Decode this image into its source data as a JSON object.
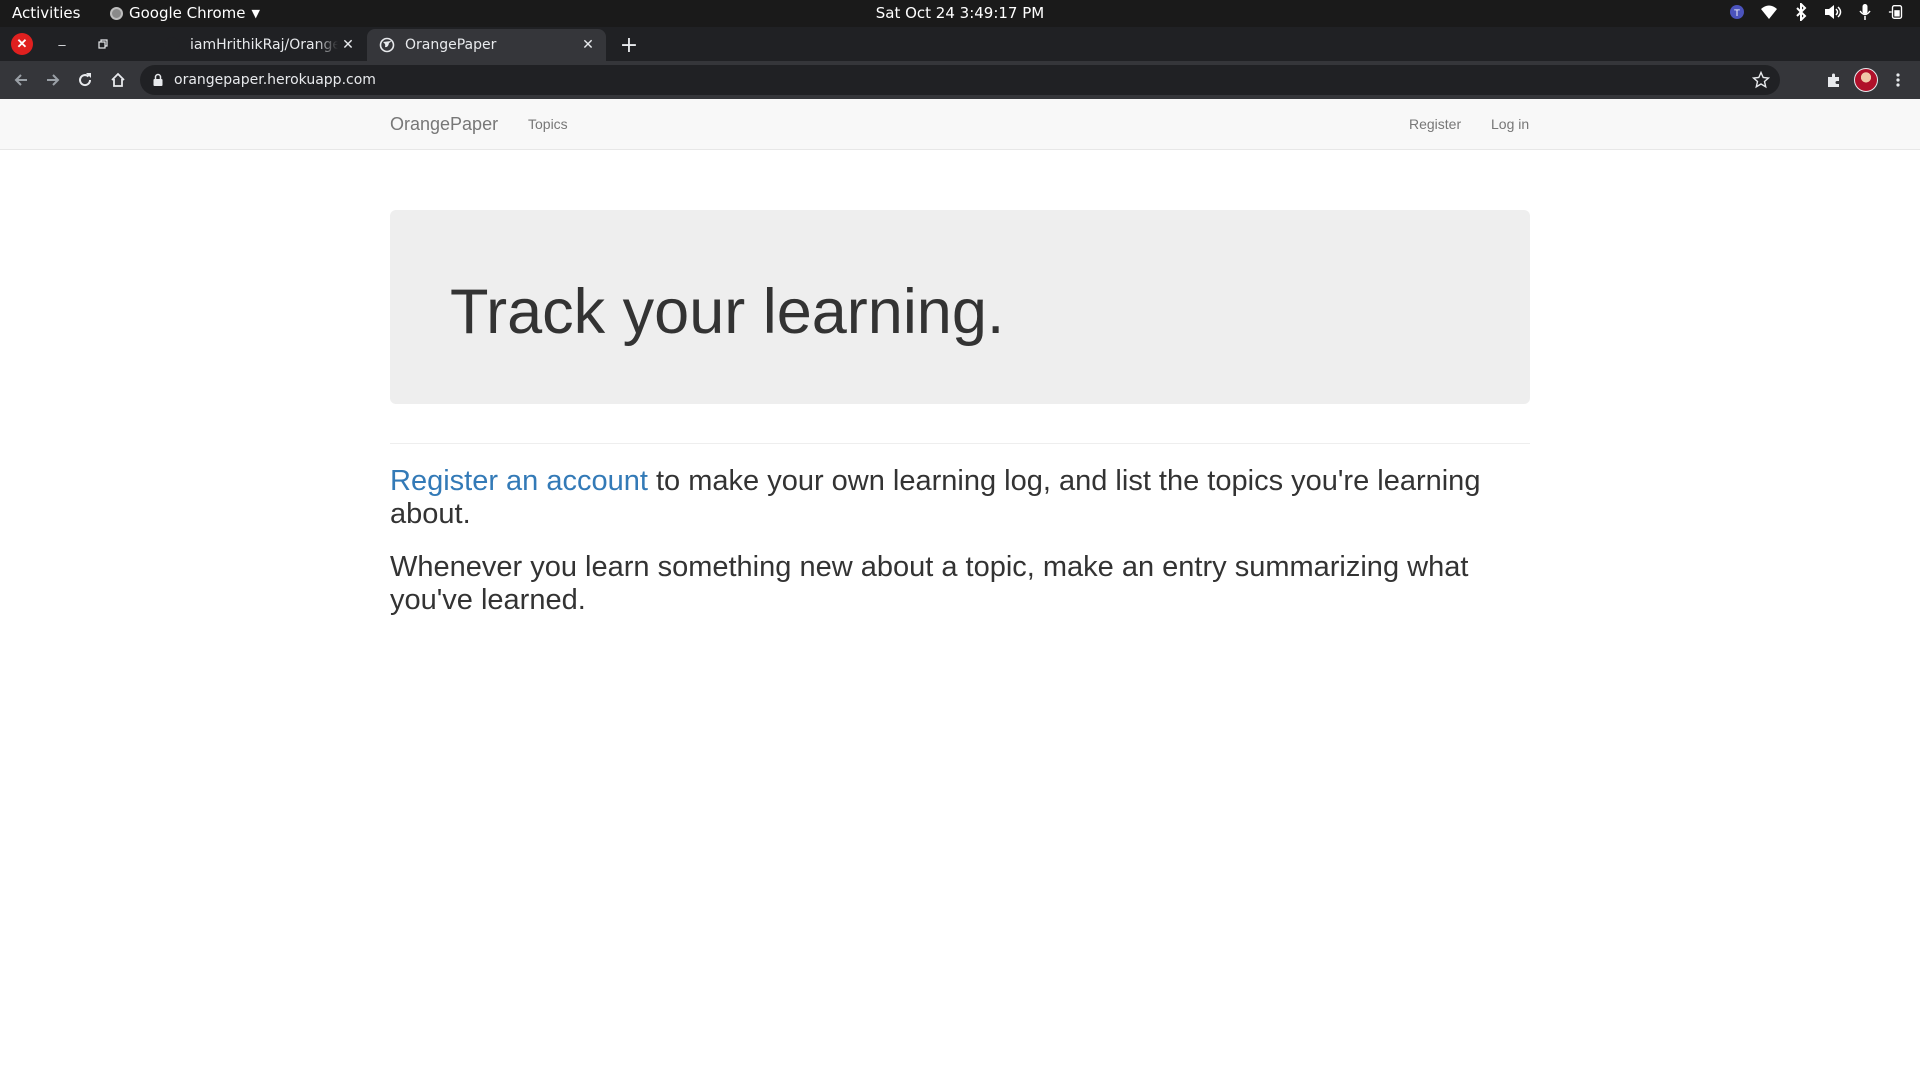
{
  "topbar": {
    "activities": "Activities",
    "app_name": "Google Chrome",
    "clock": "Sat Oct 24  3:49:17 PM",
    "tray_icons": [
      "teams-icon",
      "wifi-icon",
      "bluetooth-icon",
      "volume-icon",
      "microphone-icon",
      "battery-icon"
    ]
  },
  "browser": {
    "tabs": [
      {
        "title": "iamHrithikRaj/OrangePaper",
        "favicon": "github-icon",
        "active": false
      },
      {
        "title": "OrangePaper",
        "favicon": "globe-icon",
        "active": true
      }
    ],
    "url": "orangepaper.herokuapp.com"
  },
  "site": {
    "brand": "OrangePaper",
    "nav": {
      "topics": "Topics",
      "register": "Register",
      "login": "Log in"
    },
    "jumbotron_heading": "Track your learning.",
    "lead1": {
      "link": "Register an account",
      "text": " to make your own learning log, and list the topics you're learning about."
    },
    "lead2": "Whenever you learn something new about a topic, make an entry summarizing what you've learned.",
    "colors": {
      "link": "#337ab7",
      "text": "#333333",
      "navbar_bg": "#f8f8f8",
      "jumbotron_bg": "#eeeeee"
    }
  }
}
